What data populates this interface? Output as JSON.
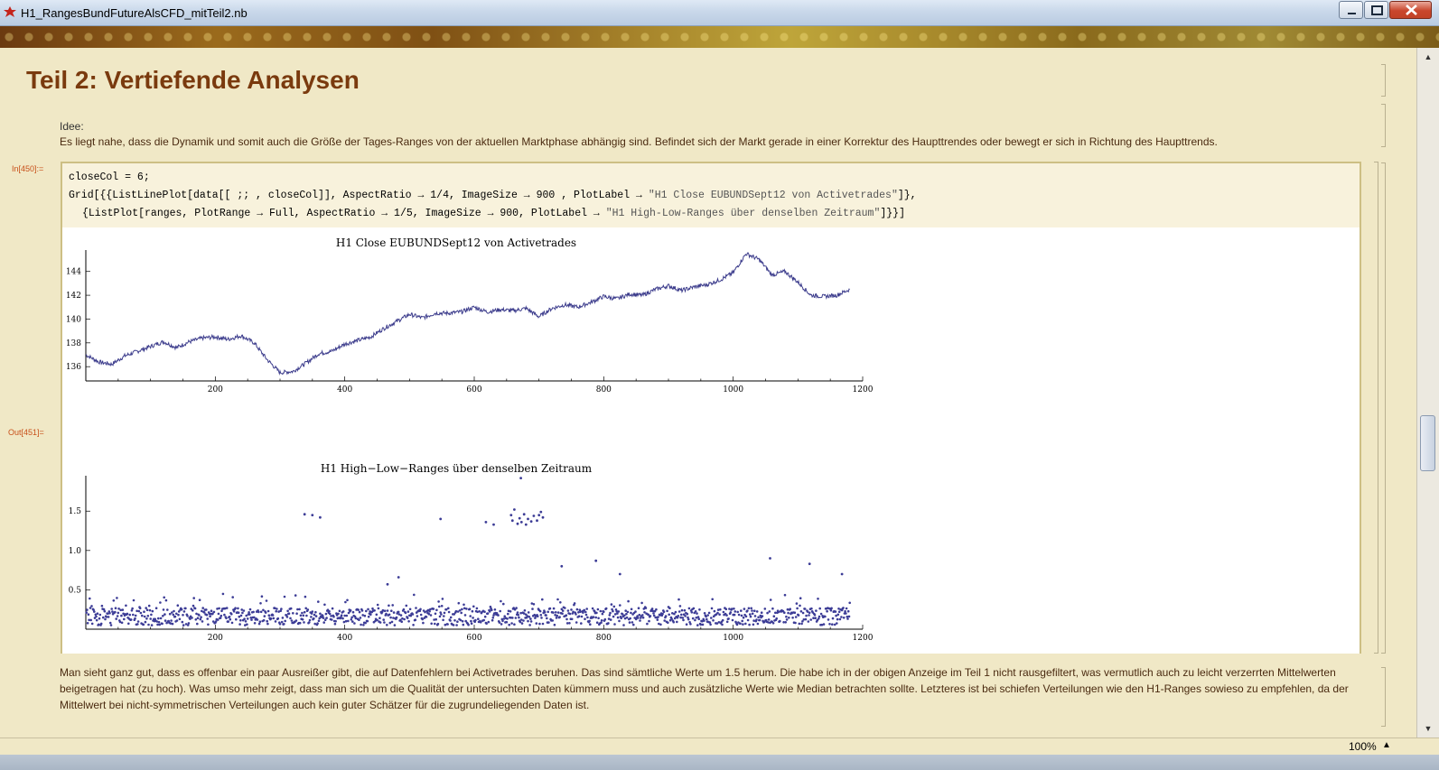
{
  "window": {
    "title": "H1_RangesBundFutureAlsCFD_mitTeil2.nb",
    "minimize_icon": "minimize-icon",
    "maximize_icon": "maximize-icon",
    "close_icon": "close-icon"
  },
  "notebook": {
    "heading": "Teil 2: Vertiefende Analysen",
    "idea_label": "Idee:",
    "idea_text": "Es liegt nahe, dass die Dynamik und somit auch die Größe der Tages-Ranges von der aktuellen Marktphase abhängig sind. Befindet sich der Markt gerade in einer Korrektur des Haupttrendes oder bewegt er sich in Richtung des Haupttrends.",
    "in_label": "In[450]:=",
    "out_label": "Out[451]=",
    "code": {
      "line1": "closeCol = 6;",
      "line2_prefix": "Grid[{{ListLinePlot[data[[ ;; , closeCol]], AspectRatio → 1/4, ImageSize → 900 , PlotLabel → ",
      "line2_string": "\"H1 Close EUBUNDSept12 von Activetrades\"",
      "line2_suffix": "]},",
      "line3_prefix": "{ListPlot[ranges, PlotRange → Full, AspectRatio → 1/5, ImageSize → 900, PlotLabel → ",
      "line3_string": "\"H1 High-Low-Ranges über denselben Zeitraum\"",
      "line3_suffix": "]}}]"
    },
    "summary_lines": [
      "Man sieht ganz gut, dass es offenbar ein paar Ausreißer gibt, die auf Datenfehlern bei Activetrades beruhen. Das sind sämtliche Werte um 1.5 herum. Die habe ich in der obigen Anzeige im Teil 1 nicht rausgefiltert, was vermutlich auch zu leicht verzerrten Mittelwerten",
      "beigetragen hat (zu hoch). Was umso mehr zeigt, dass man sich um die Qualität der untersuchten Daten kümmern muss und auch zusätzliche Werte wie Median betrachten sollte. Letzteres ist bei schiefen Verteilungen wie den H1-Ranges sowieso zu empfehlen, da der",
      "Mittelwert bei nicht-symmetrischen Verteilungen auch kein guter Schätzer für die zugrundeliegenden Daten ist."
    ]
  },
  "status": {
    "zoom": "100%",
    "zoom_arrow_icon": "triangle-up-icon"
  },
  "colors": {
    "line": "#3c3c8c",
    "point": "#3c3c96",
    "heading": "#7a3a0e",
    "cell_label": "#c8501a"
  },
  "chart_data": [
    {
      "type": "line",
      "title": "H1 Close EUBUNDSept12 von Activetrades",
      "xlim": [
        0,
        1200
      ],
      "ylim": [
        134.8,
        145.8
      ],
      "x_ticks": [
        200,
        400,
        600,
        800,
        1000,
        1200
      ],
      "y_ticks": [
        136,
        138,
        140,
        142,
        144
      ],
      "series": [
        {
          "x": [
            0,
            20,
            40,
            60,
            80,
            100,
            120,
            140,
            160,
            180,
            200,
            220,
            240,
            260,
            280,
            300,
            320,
            340,
            360,
            380,
            400,
            420,
            440,
            460,
            480,
            500,
            520,
            540,
            560,
            580,
            600,
            620,
            640,
            660,
            680,
            700,
            720,
            740,
            760,
            780,
            800,
            820,
            840,
            860,
            880,
            900,
            920,
            940,
            960,
            980,
            1000,
            1020,
            1040,
            1060,
            1080,
            1100,
            1120,
            1140,
            1160,
            1180
          ],
          "y": [
            137.0,
            136.4,
            136.2,
            136.9,
            137.3,
            137.7,
            138.1,
            137.6,
            138.1,
            138.4,
            138.5,
            138.3,
            138.6,
            138.0,
            136.6,
            135.5,
            135.6,
            136.3,
            137.1,
            137.3,
            137.9,
            138.2,
            138.5,
            139.2,
            139.8,
            140.4,
            140.1,
            140.5,
            140.5,
            140.6,
            141.0,
            140.6,
            140.8,
            140.7,
            140.9,
            140.2,
            140.9,
            141.2,
            141.0,
            141.4,
            141.9,
            141.7,
            142.1,
            142.0,
            142.5,
            142.8,
            142.4,
            142.7,
            142.9,
            143.3,
            143.9,
            145.5,
            145.0,
            143.7,
            144.0,
            143.1,
            142.0,
            141.9,
            142.0,
            142.5
          ]
        }
      ]
    },
    {
      "type": "scatter",
      "title": "H1 High−Low−Ranges über denselben Zeitraum",
      "xlim": [
        0,
        1200
      ],
      "ylim": [
        0,
        1.95
      ],
      "x_ticks": [
        200,
        400,
        600,
        800,
        1000,
        1200
      ],
      "y_ticks": [
        0.5,
        1.0,
        1.5
      ],
      "outliers": {
        "x": [
          338,
          350,
          362,
          548,
          618,
          630,
          657,
          659,
          662,
          667,
          670,
          673,
          677,
          680,
          683,
          688,
          692,
          697,
          700,
          703,
          706,
          672,
          735,
          788,
          825,
          1057,
          1118,
          1168,
          466,
          483
        ],
        "y": [
          1.46,
          1.45,
          1.42,
          1.4,
          1.36,
          1.33,
          1.45,
          1.38,
          1.52,
          1.34,
          1.41,
          1.36,
          1.46,
          1.33,
          1.4,
          1.37,
          1.44,
          1.38,
          1.45,
          1.49,
          1.42,
          1.92,
          0.8,
          0.87,
          0.7,
          0.9,
          0.83,
          0.7,
          0.57,
          0.66
        ]
      },
      "bulk_range": [
        0.02,
        0.45
      ]
    }
  ]
}
